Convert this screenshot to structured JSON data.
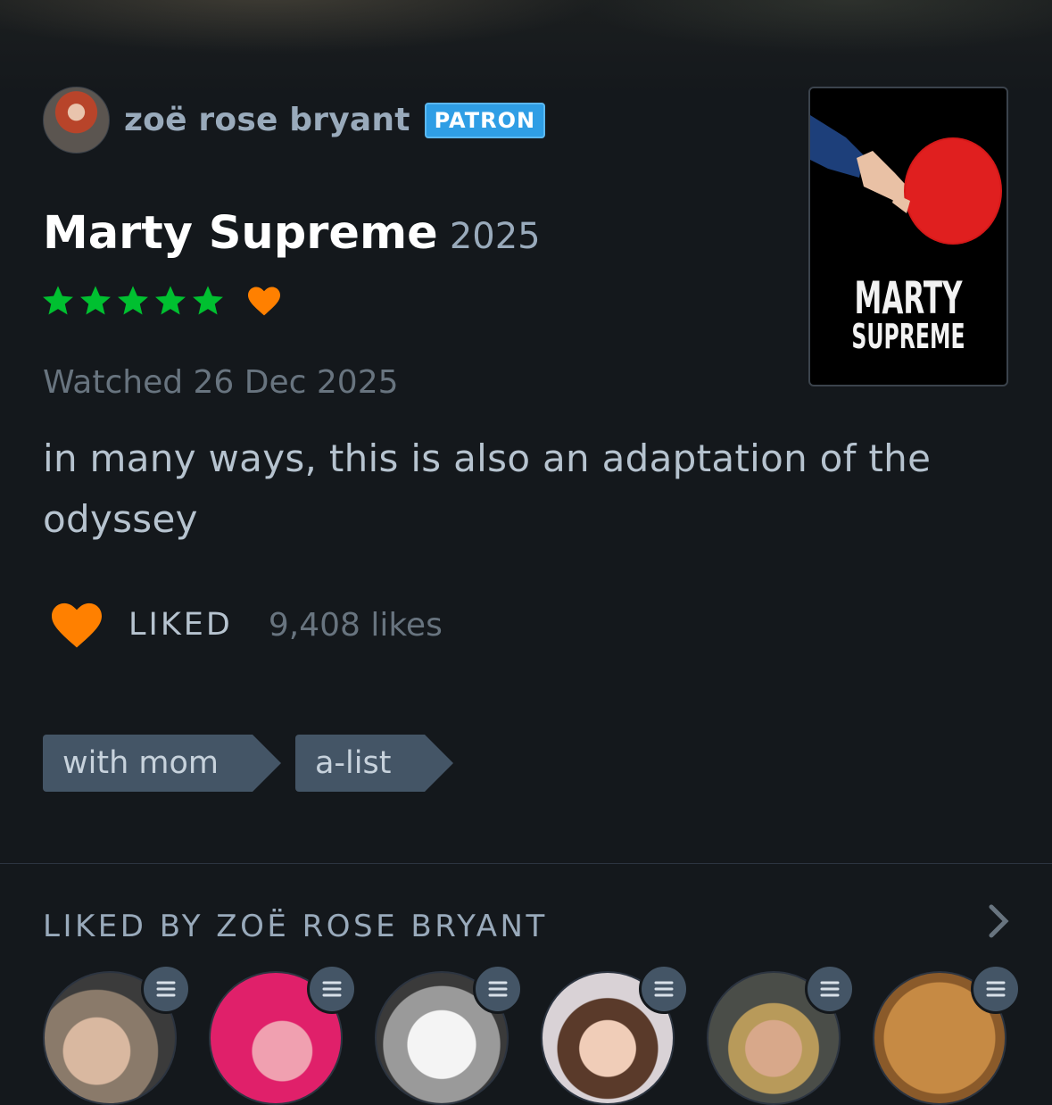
{
  "author": {
    "name": "zoë rose bryant",
    "badge": "PATRON",
    "avatar": "avatar-photo"
  },
  "film": {
    "title": "Marty Supreme",
    "year": "2025",
    "rating_stars": 5,
    "liked": true
  },
  "poster": {
    "title_line1": "MARTY",
    "title_line2": "SUPREME",
    "paddle_color": "#e01f1f"
  },
  "watched_text": "Watched 26 Dec 2025",
  "review_text": "in many ways, this is also an adaptation of the odyssey",
  "like": {
    "label": "LIKED",
    "count": "9,408 likes"
  },
  "tags": [
    "with mom",
    "a-list"
  ],
  "liked_by": {
    "title": "LIKED BY ZOË ROSE BRYANT",
    "members": [
      {
        "avatar": "avatar-blonde-man"
      },
      {
        "avatar": "avatar-illustrated-pink"
      },
      {
        "avatar": "avatar-manga-white-hair"
      },
      {
        "avatar": "avatar-woman-portrait"
      },
      {
        "avatar": "avatar-man-mustache"
      },
      {
        "avatar": "avatar-bronze-emblem"
      }
    ]
  },
  "colors": {
    "background": "#14181c",
    "star": "#00c030",
    "heart": "#ff8000",
    "patron": "#2f9ee5",
    "tag": "#445566",
    "muted": "#99aabb"
  }
}
